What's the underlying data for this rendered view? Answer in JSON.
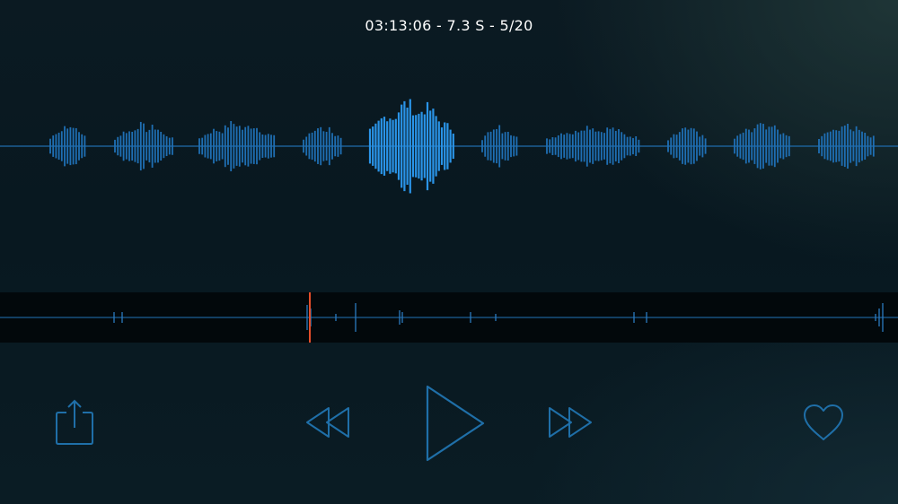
{
  "header": {
    "info": "03:13:06 - 7.3 S - 5/20"
  },
  "recording": {
    "active_clip": 5,
    "total_clips": 20,
    "clip_duration_s": 7.3,
    "timestamp": "03:13:06"
  },
  "timeline": {
    "playhead_fraction": 0.345
  },
  "controls": {
    "share": "share-icon",
    "rewind": "rewind-icon",
    "play": "play-icon",
    "fast_forward": "fast-forward-icon",
    "favorite": "heart-icon"
  },
  "colors": {
    "background": "#081820",
    "waveform": "#1f6fb4",
    "waveform_active": "#2a94e8",
    "timeline_bg": "#02080b",
    "playhead": "#e34d2a",
    "controls": "#1f6fa8"
  }
}
